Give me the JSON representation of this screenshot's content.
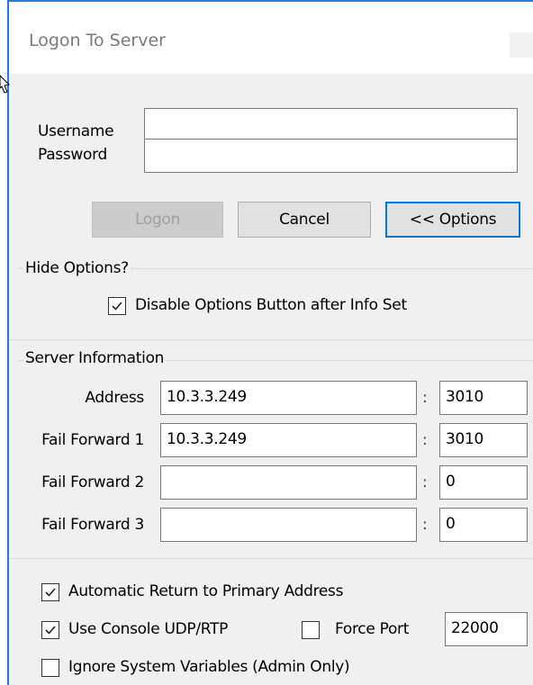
{
  "window": {
    "title": "Logon To Server"
  },
  "login": {
    "username_label": "Username",
    "password_label": "Password",
    "username_value": "",
    "password_value": ""
  },
  "buttons": {
    "logon": "Logon",
    "cancel": "Cancel",
    "options": "<< Options"
  },
  "hide_options": {
    "legend": "Hide Options?",
    "disable_options_label": "Disable Options Button after Info Set",
    "disable_options_checked": true
  },
  "server": {
    "legend": "Server Information",
    "colon": ":",
    "rows": [
      {
        "label": "Address",
        "host": "10.3.3.249",
        "port": "3010"
      },
      {
        "label": "Fail Forward 1",
        "host": "10.3.3.249",
        "port": "3010"
      },
      {
        "label": "Fail Forward 2",
        "host": "",
        "port": "0"
      },
      {
        "label": "Fail Forward 3",
        "host": "",
        "port": "0"
      }
    ]
  },
  "bottom": {
    "auto_return_label": "Automatic Return to Primary Address",
    "auto_return_checked": true,
    "use_console_label": "Use Console UDP/RTP",
    "use_console_checked": true,
    "force_port_label": "Force Port",
    "force_port_checked": false,
    "force_port_value": "22000",
    "ignore_vars_label": "Ignore System Variables (Admin Only)",
    "ignore_vars_checked": false
  },
  "colors": {
    "window_border": "#2b79d0",
    "default_button_border": "#0078d7",
    "dialog_background": "#f0f0f0"
  }
}
